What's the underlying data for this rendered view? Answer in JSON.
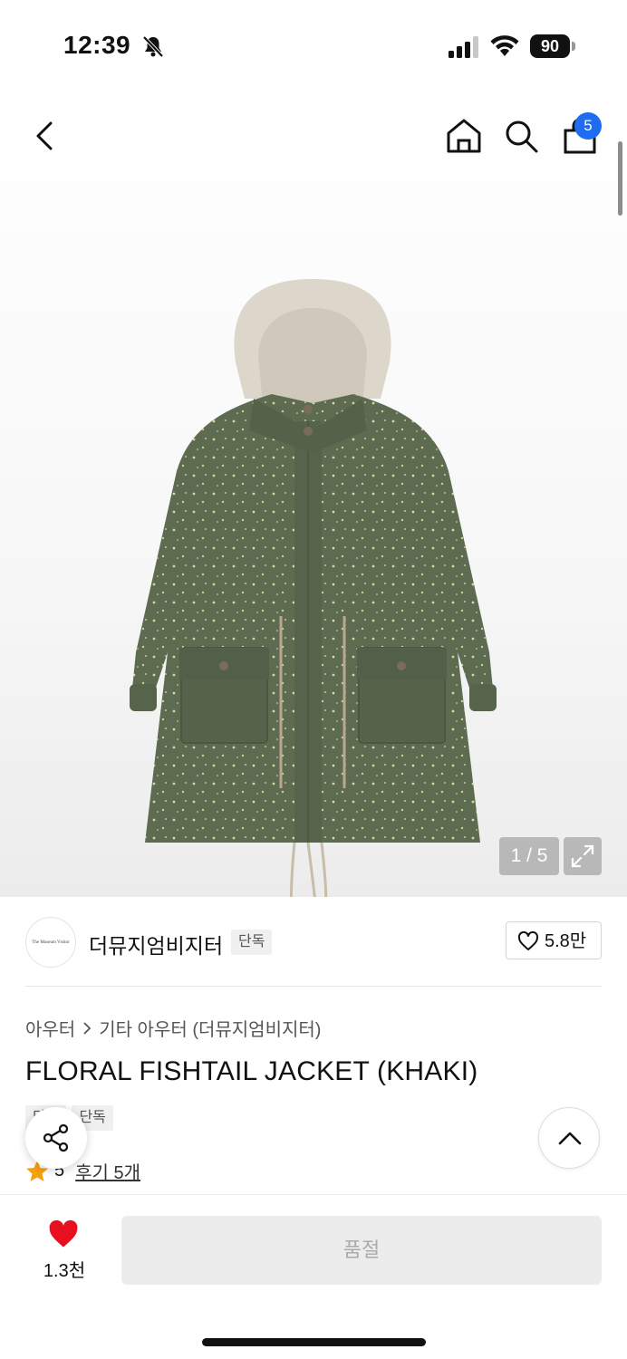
{
  "status_bar": {
    "time": "12:39",
    "battery": "90"
  },
  "nav": {
    "cart_count": "5"
  },
  "gallery": {
    "page_indicator": "1 / 5",
    "product_image": "floral fishtail jacket khaki photo"
  },
  "brand": {
    "logo_text": "The Museum Visitor",
    "name": "더뮤지엄비지터",
    "exclusive_tag": "단독",
    "like_count": "5.8만"
  },
  "breadcrumb": {
    "category": "아우터",
    "subcategory": "기타 아우터 (더뮤지엄비지터)"
  },
  "product": {
    "title": "FLORAL FISHTAIL JACKET (KHAKI)",
    "tags": [
      "단독",
      "단독"
    ]
  },
  "rating": {
    "value": "5",
    "review_link": "후기 5개"
  },
  "bottom_bar": {
    "wish_count": "1.3천",
    "purchase_button": "품절"
  },
  "colors": {
    "accent_blue": "#1f6cf0",
    "heart_red": "#e8101f",
    "star_orange": "#f5a00e",
    "jacket_khaki": "#5d6b51"
  }
}
